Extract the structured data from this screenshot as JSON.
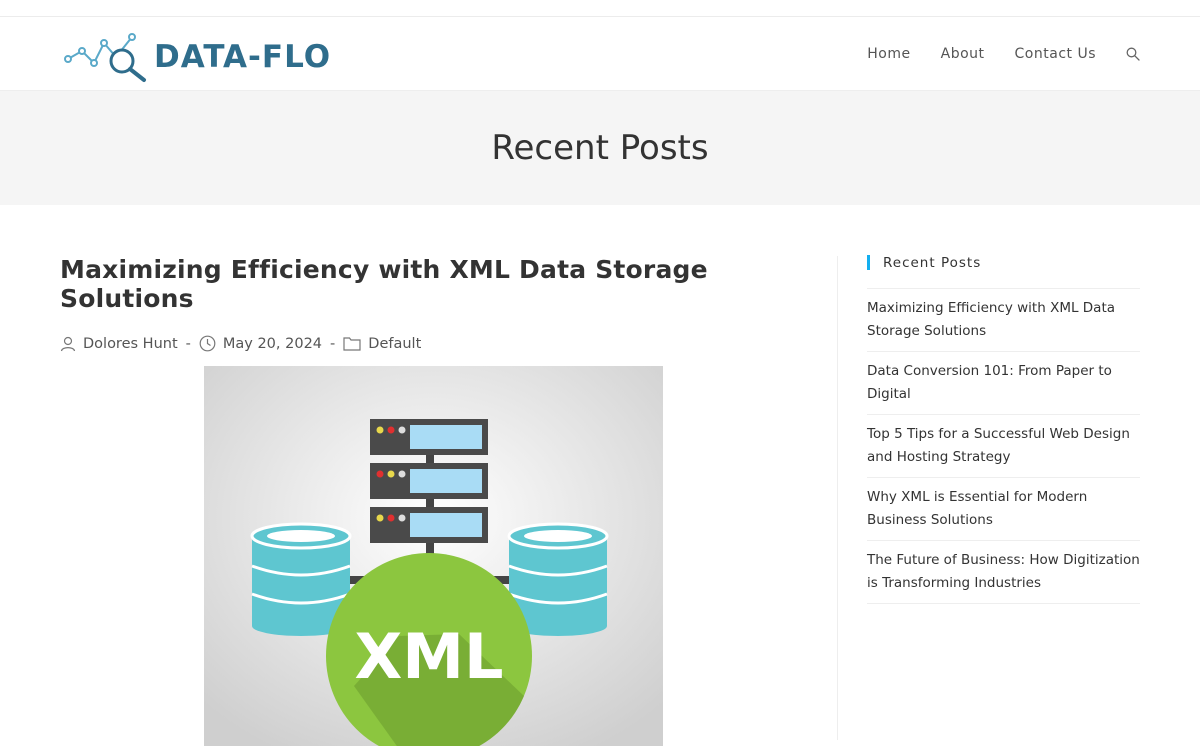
{
  "brand": {
    "logo_text": "DATA-FLO"
  },
  "nav": {
    "items": [
      "Home",
      "About",
      "Contact Us"
    ],
    "search_icon": "search-icon"
  },
  "hero": {
    "title": "Recent Posts"
  },
  "post": {
    "title": "Maximizing Efficiency with XML Data Storage Solutions",
    "author": "Dolores Hunt",
    "date": "May 20, 2024",
    "category": "Default",
    "image_label": "XML"
  },
  "sidebar": {
    "title": "Recent Posts",
    "items": [
      "Maximizing Efficiency with XML Data Storage Solutions",
      "Data Conversion 101: From Paper to Digital",
      "Top 5 Tips for a Successful Web Design and Hosting Strategy",
      "Why XML is Essential for Modern Business Solutions",
      "The Future of Business: How Digitization is Transforming Industries"
    ]
  },
  "colors": {
    "brand": "#2f6d8c",
    "accent": "#13aff0",
    "hero_bg": "#f5f5f5",
    "xml_green": "#8cc63f",
    "db_teal": "#5ec6d0"
  }
}
